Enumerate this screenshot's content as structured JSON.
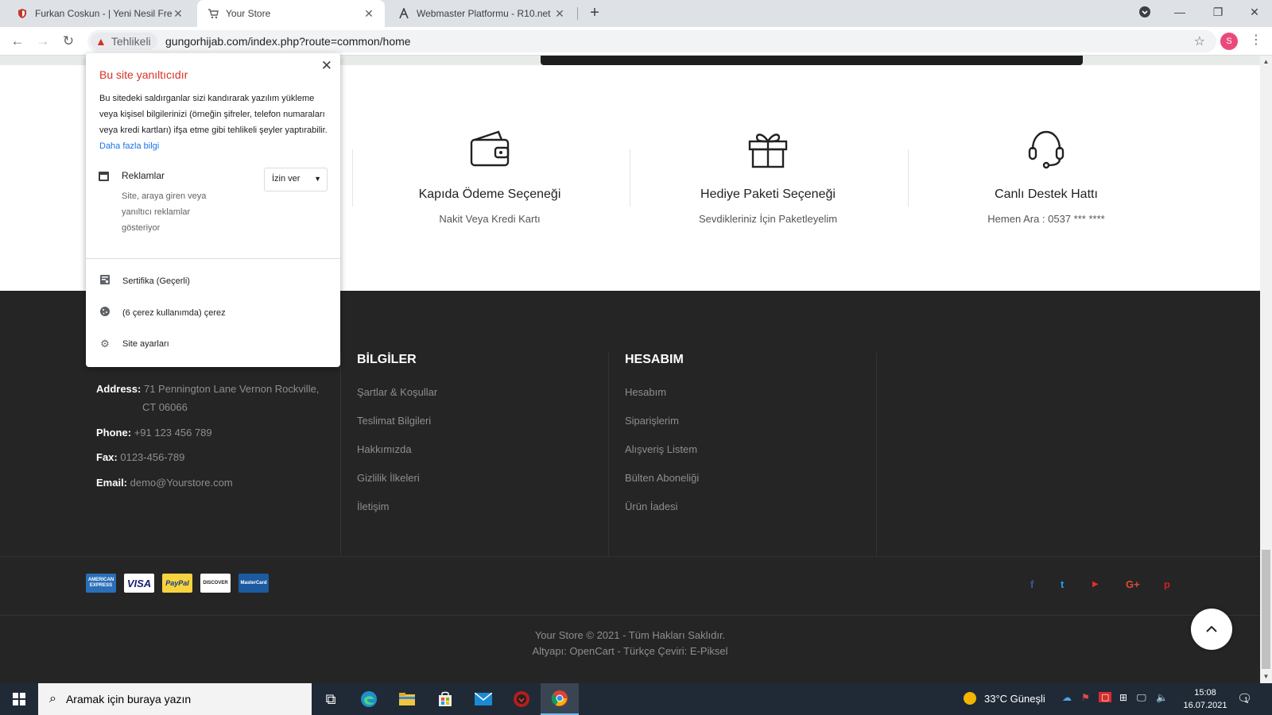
{
  "browser": {
    "tabs": [
      {
        "title": "Furkan Coskun - | Yeni Nesil Free"
      },
      {
        "title": "Your Store"
      },
      {
        "title": "Webmaster Platformu - R10.net"
      }
    ],
    "security_chip": "Tehlikeli",
    "url": "gungorhijab.com/index.php?route=common/home",
    "profile_initial": "S"
  },
  "popup": {
    "title": "Bu site yanıltıcıdır",
    "description": "Bu sitedeki saldırganlar sizi kandırarak yazılım yükleme veya kişisel bilgilerinizi (örneğin şifreler, telefon numaraları veya kredi kartları) ifşa etme gibi tehlikeli şeyler yaptırabilir.",
    "learn_more": "Daha fazla bilgi",
    "ads_label": "Reklamlar",
    "ads_description": "Site, araya giren veya yanıltıcı reklamlar gösteriyor",
    "ads_select_value": "İzin ver",
    "certificate": "Sertifika (Geçerli)",
    "cookies": "(6 çerez kullanımda) çerez",
    "site_settings": "Site ayarları"
  },
  "features": [
    {
      "title": "Kapıda Ödeme Seçeneği",
      "subtitle": "Nakit Veya Kredi Kartı",
      "icon": "wallet-icon"
    },
    {
      "title": "Hediye Paketi Seçeneği",
      "subtitle": "Sevdikleriniz İçin Paketleyelim",
      "icon": "gift-icon"
    },
    {
      "title": "Canlı Destek Hattı",
      "subtitle": "Hemen Ara : 0537 *** ****",
      "icon": "headset-icon"
    }
  ],
  "footer": {
    "contact": {
      "address_label": "Address:",
      "address_line1": "71 Pennington Lane Vernon Rockville,",
      "address_line2": "CT 06066",
      "phone_label": "Phone:",
      "phone": "+91 123 456 789",
      "fax_label": "Fax:",
      "fax": "0123-456-789",
      "email_label": "Email:",
      "email": "demo@Yourstore.com"
    },
    "info": {
      "title": "BİLGİLER",
      "links": [
        "Şartlar & Koşullar",
        "Teslimat Bilgileri",
        "Hakkımızda",
        "Gizlilik İlkeleri",
        "İletişim"
      ]
    },
    "account": {
      "title": "HESABIM",
      "links": [
        "Hesabım",
        "Siparişlerim",
        "Alışveriş Listem",
        "Bülten Aboneliği",
        "Ürün İadesi"
      ]
    },
    "payments": [
      "AMERICAN EXPRESS",
      "VISA",
      "PayPal",
      "DISCOVER",
      "MasterCard"
    ],
    "social": [
      "f",
      "t",
      "▶",
      "G+",
      "p"
    ],
    "copyright": "Your Store © 2021 - Tüm Hakları Saklıdır.",
    "powered": "Altyapı: OpenCart - Türkçe Çeviri: E-Piksel"
  },
  "taskbar": {
    "search_placeholder": "Aramak için buraya yazın",
    "weather": "33°C  Güneşli",
    "time": "15:08",
    "date": "16.07.2021",
    "notification_count": "1"
  },
  "colors": {
    "danger": "#d93025",
    "link": "#1a73e8",
    "footer_bg": "#252525",
    "social": "#d03a3a"
  }
}
